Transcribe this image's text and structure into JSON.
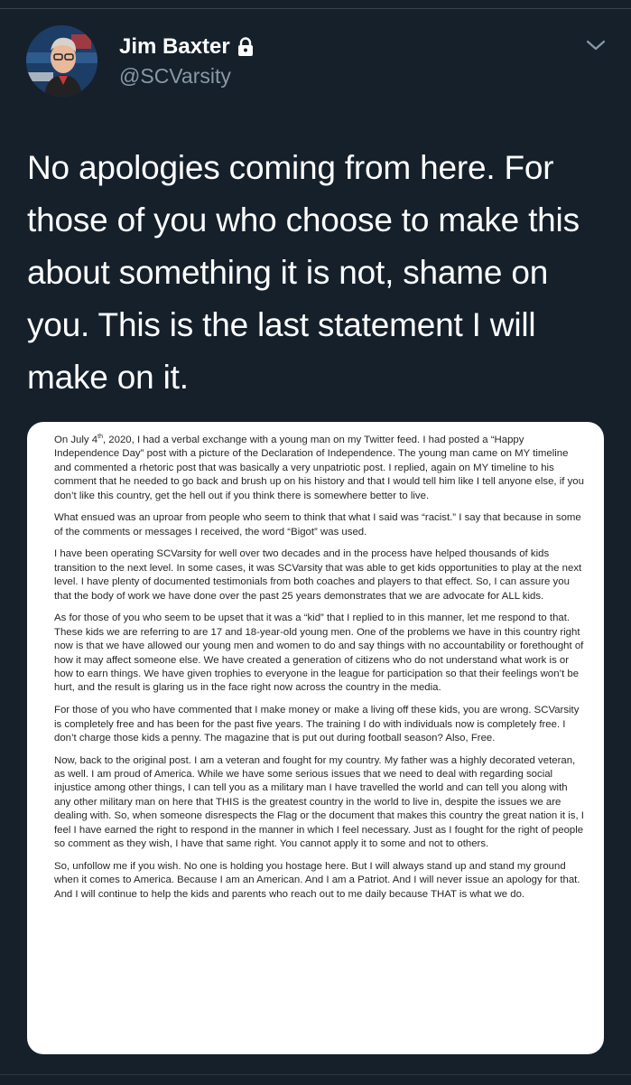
{
  "tweet": {
    "display_name": "Jim Baxter",
    "handle": "@SCVarsity",
    "text": "No apologies coming from here. For those of you who choose to make this about something it is not, shame on you. This is the last statement I will make on it."
  },
  "icons": {
    "lock": "lock-icon",
    "menu": "chevron-down-icon"
  },
  "colors": {
    "background": "#15202b",
    "secondary_text": "#8899a6"
  },
  "letter": {
    "p1_pre": "On July 4",
    "p1_sup": "th",
    "p1_post": ", 2020, I had a verbal exchange with a young man on my Twitter feed. I had posted a “Happy Independence Day” post with a picture of the Declaration of Independence. The young man came on MY timeline and commented a rhetoric post that was basically a very unpatriotic post. I replied, again on MY timeline to his comment that he needed to go back and brush up on his history and that I would tell him like I tell anyone else, if you don’t like this country, get the hell out if you think there is somewhere better to live.",
    "p2": "What ensued was an uproar from people who seem to think that what I said was “racist.” I say that because in some of the comments or messages I received, the word “Bigot” was used.",
    "p3": "I have been operating SCVarsity for well over two decades and in the process have helped thousands of kids transition to the next level. In some cases, it was SCVarsity that was able to get kids opportunities to play at the next level. I have plenty of documented testimonials from both coaches and players to that effect. So, I can assure you that the body of work we have done over the past 25 years demonstrates that we are advocate for ALL kids.",
    "p4": "As for those of you who seem to be upset that it was a “kid” that I replied to in this manner, let me respond to that. These kids we are referring to are 17 and 18-year-old young men. One of the problems we have in this country right now is that we have allowed our young men and women to do and say things with no accountability or forethought of how it may affect someone else. We have created a generation of citizens who do not understand what work is or how to earn things. We have given trophies to everyone in the league for participation so that their feelings won’t be hurt, and the result is glaring us in the face right now across the country in the media.",
    "p5": "For those of you who have commented that I make money or make a living off these kids, you are wrong. SCVarsity is completely free and has been for the past five years. The training I do with individuals now is completely free. I don’t charge those kids a penny. The magazine that is put out during football season? Also, Free.",
    "p6": "Now, back to the original post. I am a veteran and fought for my country. My father was a highly decorated veteran, as well. I am proud of America. While we have some serious issues that we need to deal with regarding social injustice among other things, I can tell you as a military man I have travelled the world and can tell you along with any other military man on here that THIS is the greatest country in the world to live in, despite the issues we are dealing with. So, when someone disrespects the Flag or the document that makes this country the great nation it is, I feel I have earned the right to respond in the manner in which I feel necessary. Just as I fought for the right of people so comment as they wish, I have that same right. You cannot apply it to some and not to others.",
    "p7": "So, unfollow me if you wish. No one is holding you hostage here. But I will always stand up and stand my ground when it comes to America. Because I am an American. And I am a Patriot. And I will never issue an apology for that. And I will continue to help the kids and parents who reach out to me daily because THAT is what we do."
  }
}
